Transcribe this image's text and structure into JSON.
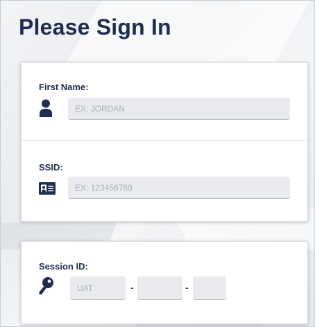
{
  "page": {
    "title": "Please Sign In"
  },
  "form": {
    "first_name": {
      "label": "First Name:",
      "placeholder": "EX: JORDAN",
      "icon": "person-icon"
    },
    "ssid": {
      "label": "SSID:",
      "placeholder": "EX: 123456789",
      "icon": "id-card-icon"
    },
    "session_id": {
      "label": "Session ID:",
      "icon": "key-icon",
      "part1_placeholder": "UAT",
      "part2_placeholder": "",
      "part3_placeholder": "",
      "separator": "-"
    }
  },
  "colors": {
    "heading": "#1f2d4f",
    "input_bg": "#e8eaed",
    "placeholder": "#aab0b8"
  }
}
